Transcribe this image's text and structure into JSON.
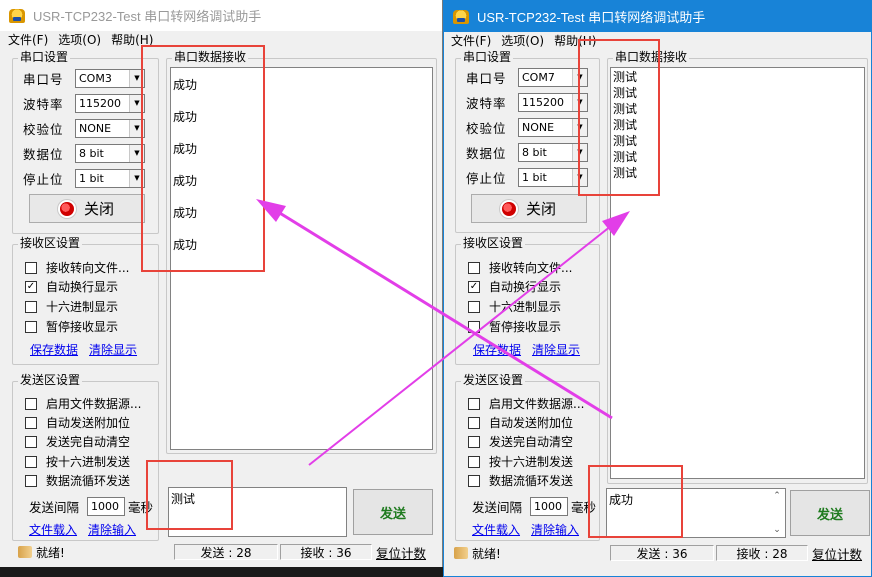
{
  "left_window": {
    "title": "USR-TCP232-Test 串口转网络调试助手",
    "menu": [
      "文件(F)",
      "选项(O)",
      "帮助(H)"
    ],
    "serial_settings": {
      "title": "串口设置",
      "rows": [
        {
          "label": "串口号",
          "value": "COM3"
        },
        {
          "label": "波特率",
          "value": "115200"
        },
        {
          "label": "校验位",
          "value": "NONE"
        },
        {
          "label": "数据位",
          "value": "8 bit"
        },
        {
          "label": "停止位",
          "value": "1 bit"
        }
      ],
      "button": "关闭"
    },
    "recv_settings": {
      "title": "接收区设置",
      "options": [
        {
          "label": "接收转向文件...",
          "checked": false
        },
        {
          "label": "自动换行显示",
          "checked": true
        },
        {
          "label": "十六进制显示",
          "checked": false
        },
        {
          "label": "暂停接收显示",
          "checked": false
        }
      ],
      "link_save": "保存数据",
      "link_clear": "清除显示"
    },
    "send_settings": {
      "title": "发送区设置",
      "options": [
        {
          "label": "启用文件数据源...",
          "checked": false
        },
        {
          "label": "自动发送附加位",
          "checked": false
        },
        {
          "label": "发送完自动清空",
          "checked": false
        },
        {
          "label": "按十六进制发送",
          "checked": false
        },
        {
          "label": "数据流循环发送",
          "checked": false
        }
      ],
      "interval_label": "发送间隔",
      "interval_value": "1000",
      "interval_unit": "毫秒",
      "link_load": "文件载入",
      "link_clear": "清除输入"
    },
    "recv_area": {
      "title": "串口数据接收",
      "lines": [
        "成功",
        "成功",
        "成功",
        "成功",
        "成功",
        "成功"
      ]
    },
    "send_text": "测试",
    "send_button": "发送",
    "status": {
      "ready": "就绪!",
      "sent": "发送 : 28",
      "received": "接收 : 36",
      "reset": "复位计数"
    }
  },
  "right_window": {
    "title": "USR-TCP232-Test 串口转网络调试助手",
    "menu": [
      "文件(F)",
      "选项(O)",
      "帮助(H)"
    ],
    "serial_settings": {
      "title": "串口设置",
      "rows": [
        {
          "label": "串口号",
          "value": "COM7"
        },
        {
          "label": "波特率",
          "value": "115200"
        },
        {
          "label": "校验位",
          "value": "NONE"
        },
        {
          "label": "数据位",
          "value": "8 bit"
        },
        {
          "label": "停止位",
          "value": "1 bit"
        }
      ],
      "button": "关闭"
    },
    "recv_settings": {
      "title": "接收区设置",
      "options": [
        {
          "label": "接收转向文件...",
          "checked": false
        },
        {
          "label": "自动换行显示",
          "checked": true
        },
        {
          "label": "十六进制显示",
          "checked": false
        },
        {
          "label": "暂停接收显示",
          "checked": false
        }
      ],
      "link_save": "保存数据",
      "link_clear": "清除显示"
    },
    "send_settings": {
      "title": "发送区设置",
      "options": [
        {
          "label": "启用文件数据源...",
          "checked": false
        },
        {
          "label": "自动发送附加位",
          "checked": false
        },
        {
          "label": "发送完自动清空",
          "checked": false
        },
        {
          "label": "按十六进制发送",
          "checked": false
        },
        {
          "label": "数据流循环发送",
          "checked": false
        }
      ],
      "interval_label": "发送间隔",
      "interval_value": "1000",
      "interval_unit": "毫秒",
      "link_load": "文件载入",
      "link_clear": "清除输入"
    },
    "recv_area": {
      "title": "串口数据接收",
      "lines": [
        "测试",
        "测试",
        "测试",
        "测试",
        "测试",
        "测试",
        "测试"
      ]
    },
    "send_text": "成功",
    "send_button": "发送",
    "status": {
      "ready": "就绪!",
      "sent": "发送 : 36",
      "received": "接收 : 28",
      "reset": "复位计数"
    }
  },
  "colors": {
    "annotation_box": "#e8433a",
    "annotation_arrow": "#e23ee8",
    "title_active": "#1883d7"
  }
}
